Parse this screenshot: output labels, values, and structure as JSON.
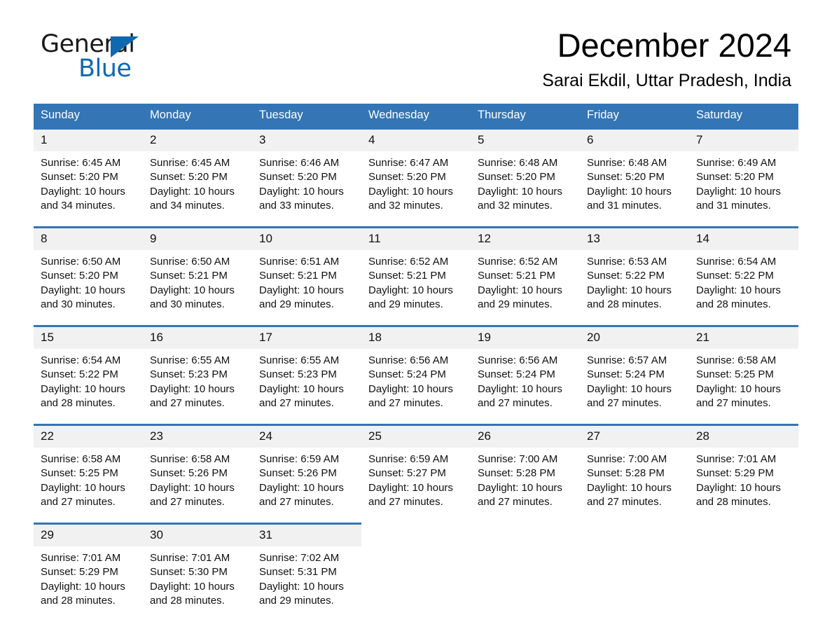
{
  "brand": {
    "name_part1": "General",
    "name_part2": "Blue",
    "triangle_icon": "brand-triangle-icon",
    "accent_color": "#1068b1"
  },
  "header": {
    "month_title": "December 2024",
    "location": "Sarai Ekdil, Uttar Pradesh, India"
  },
  "calendar": {
    "header_bg": "#3375b5",
    "daynum_bg": "#f1f1f1",
    "weekday_headers": [
      "Sunday",
      "Monday",
      "Tuesday",
      "Wednesday",
      "Thursday",
      "Friday",
      "Saturday"
    ],
    "weeks": [
      [
        {
          "day": "1",
          "sunrise": "Sunrise: 6:45 AM",
          "sunset": "Sunset: 5:20 PM",
          "daylight_line1": "Daylight: 10 hours",
          "daylight_line2": "and 34 minutes."
        },
        {
          "day": "2",
          "sunrise": "Sunrise: 6:45 AM",
          "sunset": "Sunset: 5:20 PM",
          "daylight_line1": "Daylight: 10 hours",
          "daylight_line2": "and 34 minutes."
        },
        {
          "day": "3",
          "sunrise": "Sunrise: 6:46 AM",
          "sunset": "Sunset: 5:20 PM",
          "daylight_line1": "Daylight: 10 hours",
          "daylight_line2": "and 33 minutes."
        },
        {
          "day": "4",
          "sunrise": "Sunrise: 6:47 AM",
          "sunset": "Sunset: 5:20 PM",
          "daylight_line1": "Daylight: 10 hours",
          "daylight_line2": "and 32 minutes."
        },
        {
          "day": "5",
          "sunrise": "Sunrise: 6:48 AM",
          "sunset": "Sunset: 5:20 PM",
          "daylight_line1": "Daylight: 10 hours",
          "daylight_line2": "and 32 minutes."
        },
        {
          "day": "6",
          "sunrise": "Sunrise: 6:48 AM",
          "sunset": "Sunset: 5:20 PM",
          "daylight_line1": "Daylight: 10 hours",
          "daylight_line2": "and 31 minutes."
        },
        {
          "day": "7",
          "sunrise": "Sunrise: 6:49 AM",
          "sunset": "Sunset: 5:20 PM",
          "daylight_line1": "Daylight: 10 hours",
          "daylight_line2": "and 31 minutes."
        }
      ],
      [
        {
          "day": "8",
          "sunrise": "Sunrise: 6:50 AM",
          "sunset": "Sunset: 5:20 PM",
          "daylight_line1": "Daylight: 10 hours",
          "daylight_line2": "and 30 minutes."
        },
        {
          "day": "9",
          "sunrise": "Sunrise: 6:50 AM",
          "sunset": "Sunset: 5:21 PM",
          "daylight_line1": "Daylight: 10 hours",
          "daylight_line2": "and 30 minutes."
        },
        {
          "day": "10",
          "sunrise": "Sunrise: 6:51 AM",
          "sunset": "Sunset: 5:21 PM",
          "daylight_line1": "Daylight: 10 hours",
          "daylight_line2": "and 29 minutes."
        },
        {
          "day": "11",
          "sunrise": "Sunrise: 6:52 AM",
          "sunset": "Sunset: 5:21 PM",
          "daylight_line1": "Daylight: 10 hours",
          "daylight_line2": "and 29 minutes."
        },
        {
          "day": "12",
          "sunrise": "Sunrise: 6:52 AM",
          "sunset": "Sunset: 5:21 PM",
          "daylight_line1": "Daylight: 10 hours",
          "daylight_line2": "and 29 minutes."
        },
        {
          "day": "13",
          "sunrise": "Sunrise: 6:53 AM",
          "sunset": "Sunset: 5:22 PM",
          "daylight_line1": "Daylight: 10 hours",
          "daylight_line2": "and 28 minutes."
        },
        {
          "day": "14",
          "sunrise": "Sunrise: 6:54 AM",
          "sunset": "Sunset: 5:22 PM",
          "daylight_line1": "Daylight: 10 hours",
          "daylight_line2": "and 28 minutes."
        }
      ],
      [
        {
          "day": "15",
          "sunrise": "Sunrise: 6:54 AM",
          "sunset": "Sunset: 5:22 PM",
          "daylight_line1": "Daylight: 10 hours",
          "daylight_line2": "and 28 minutes."
        },
        {
          "day": "16",
          "sunrise": "Sunrise: 6:55 AM",
          "sunset": "Sunset: 5:23 PM",
          "daylight_line1": "Daylight: 10 hours",
          "daylight_line2": "and 27 minutes."
        },
        {
          "day": "17",
          "sunrise": "Sunrise: 6:55 AM",
          "sunset": "Sunset: 5:23 PM",
          "daylight_line1": "Daylight: 10 hours",
          "daylight_line2": "and 27 minutes."
        },
        {
          "day": "18",
          "sunrise": "Sunrise: 6:56 AM",
          "sunset": "Sunset: 5:24 PM",
          "daylight_line1": "Daylight: 10 hours",
          "daylight_line2": "and 27 minutes."
        },
        {
          "day": "19",
          "sunrise": "Sunrise: 6:56 AM",
          "sunset": "Sunset: 5:24 PM",
          "daylight_line1": "Daylight: 10 hours",
          "daylight_line2": "and 27 minutes."
        },
        {
          "day": "20",
          "sunrise": "Sunrise: 6:57 AM",
          "sunset": "Sunset: 5:24 PM",
          "daylight_line1": "Daylight: 10 hours",
          "daylight_line2": "and 27 minutes."
        },
        {
          "day": "21",
          "sunrise": "Sunrise: 6:58 AM",
          "sunset": "Sunset: 5:25 PM",
          "daylight_line1": "Daylight: 10 hours",
          "daylight_line2": "and 27 minutes."
        }
      ],
      [
        {
          "day": "22",
          "sunrise": "Sunrise: 6:58 AM",
          "sunset": "Sunset: 5:25 PM",
          "daylight_line1": "Daylight: 10 hours",
          "daylight_line2": "and 27 minutes."
        },
        {
          "day": "23",
          "sunrise": "Sunrise: 6:58 AM",
          "sunset": "Sunset: 5:26 PM",
          "daylight_line1": "Daylight: 10 hours",
          "daylight_line2": "and 27 minutes."
        },
        {
          "day": "24",
          "sunrise": "Sunrise: 6:59 AM",
          "sunset": "Sunset: 5:26 PM",
          "daylight_line1": "Daylight: 10 hours",
          "daylight_line2": "and 27 minutes."
        },
        {
          "day": "25",
          "sunrise": "Sunrise: 6:59 AM",
          "sunset": "Sunset: 5:27 PM",
          "daylight_line1": "Daylight: 10 hours",
          "daylight_line2": "and 27 minutes."
        },
        {
          "day": "26",
          "sunrise": "Sunrise: 7:00 AM",
          "sunset": "Sunset: 5:28 PM",
          "daylight_line1": "Daylight: 10 hours",
          "daylight_line2": "and 27 minutes."
        },
        {
          "day": "27",
          "sunrise": "Sunrise: 7:00 AM",
          "sunset": "Sunset: 5:28 PM",
          "daylight_line1": "Daylight: 10 hours",
          "daylight_line2": "and 27 minutes."
        },
        {
          "day": "28",
          "sunrise": "Sunrise: 7:01 AM",
          "sunset": "Sunset: 5:29 PM",
          "daylight_line1": "Daylight: 10 hours",
          "daylight_line2": "and 28 minutes."
        }
      ],
      [
        {
          "day": "29",
          "sunrise": "Sunrise: 7:01 AM",
          "sunset": "Sunset: 5:29 PM",
          "daylight_line1": "Daylight: 10 hours",
          "daylight_line2": "and 28 minutes."
        },
        {
          "day": "30",
          "sunrise": "Sunrise: 7:01 AM",
          "sunset": "Sunset: 5:30 PM",
          "daylight_line1": "Daylight: 10 hours",
          "daylight_line2": "and 28 minutes."
        },
        {
          "day": "31",
          "sunrise": "Sunrise: 7:02 AM",
          "sunset": "Sunset: 5:31 PM",
          "daylight_line1": "Daylight: 10 hours",
          "daylight_line2": "and 29 minutes."
        },
        null,
        null,
        null,
        null
      ]
    ]
  }
}
